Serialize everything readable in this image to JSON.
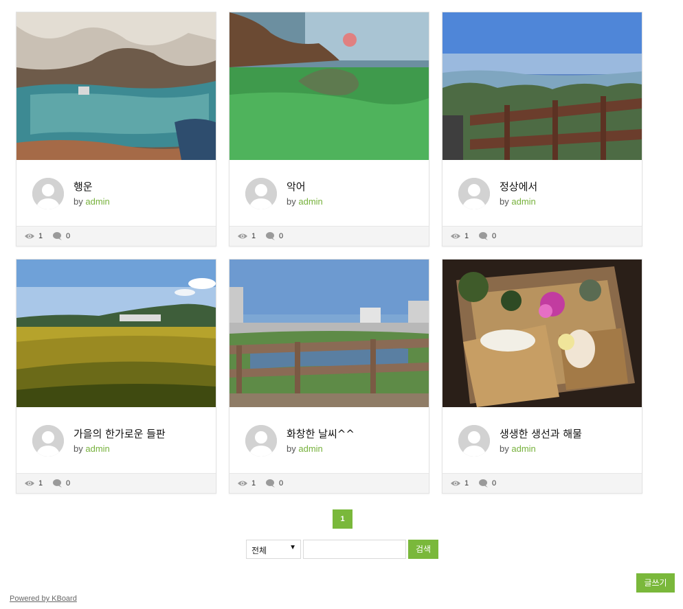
{
  "posts": [
    {
      "title": "행운",
      "by_label": "by",
      "author": "admin",
      "views": "1",
      "comments": "0",
      "image": "cave-pool-photo"
    },
    {
      "title": "악어",
      "by_label": "by",
      "author": "admin",
      "views": "1",
      "comments": "0",
      "image": "aquarium-crocodile-photo"
    },
    {
      "title": "정상에서",
      "by_label": "by",
      "author": "admin",
      "views": "1",
      "comments": "0",
      "image": "mountain-summit-view-photo"
    },
    {
      "title": "가을의 한가로운 들판",
      "by_label": "by",
      "author": "admin",
      "views": "1",
      "comments": "0",
      "image": "autumn-rice-field-photo"
    },
    {
      "title": "화창한 날씨^^",
      "by_label": "by",
      "author": "admin",
      "views": "1",
      "comments": "0",
      "image": "sunny-river-city-photo"
    },
    {
      "title": "생생한 생선과 해물",
      "by_label": "by",
      "author": "admin",
      "views": "1",
      "comments": "0",
      "image": "sashimi-platter-photo"
    }
  ],
  "pagination": {
    "current_page": "1"
  },
  "search": {
    "category_selected": "전체",
    "category_arrow": "▼",
    "query_value": "",
    "button_label": "검색"
  },
  "write_button_label": "글쓰기",
  "powered_by": "Powered by KBoard",
  "colors": {
    "accent": "#7ab83b",
    "author_link": "#76b13b"
  }
}
